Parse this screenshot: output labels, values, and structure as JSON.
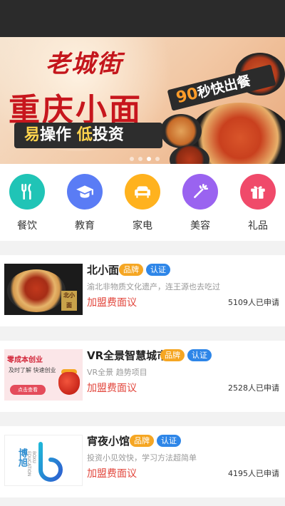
{
  "banner": {
    "brand_logo": "老城街",
    "title": "重庆小面",
    "slogan_part1": "易",
    "slogan_part2": "操作 ",
    "slogan_part3": "低",
    "slogan_part4": "投资",
    "promo_number": "90",
    "promo_text": "秒快出餐",
    "active_slide": 2,
    "slide_count": 4
  },
  "categories": [
    {
      "label": "餐饮",
      "icon": "fork-knife-icon",
      "color": "#20c4b6"
    },
    {
      "label": "教育",
      "icon": "graduation-cap-icon",
      "color": "#5a7cf5"
    },
    {
      "label": "家电",
      "icon": "sofa-icon",
      "color": "#ffb21e"
    },
    {
      "label": "美容",
      "icon": "magic-wand-icon",
      "color": "#9a63f0"
    },
    {
      "label": "礼品",
      "icon": "gift-icon",
      "color": "#f04a6a"
    }
  ],
  "listings": [
    {
      "title": "北小面",
      "badge_brand": "品牌",
      "badge_cert": "认证",
      "description": "渝北非物质文化遗产，连王源也去吃过",
      "fee": "加盟费面议",
      "applicants": "5109人已申请",
      "thumb_stamp": "北小面"
    },
    {
      "title": "VR全景智慧城市",
      "badge_brand": "品牌",
      "badge_cert": "认证",
      "description": "VR全景 趋势项目",
      "fee": "加盟费面议",
      "applicants": "2528人已申请",
      "thumb_head": "零成本创业",
      "thumb_sub": "及时了解 快速创业",
      "thumb_button": "点击查看"
    },
    {
      "title": "宵夜小馆",
      "badge_brand": "品牌",
      "badge_cert": "认证",
      "description": "投资小见效快，学习方法超简单",
      "fee": "加盟费面议",
      "applicants": "4195人已申请",
      "thumb_logo": "博旭",
      "thumb_logo_sub": "BOXU EDUCATION"
    }
  ],
  "colors": {
    "badge_brand": "#f5a623",
    "badge_cert": "#2e86e8",
    "fee": "#e2463c",
    "status_bar": "#2b2b2b"
  }
}
